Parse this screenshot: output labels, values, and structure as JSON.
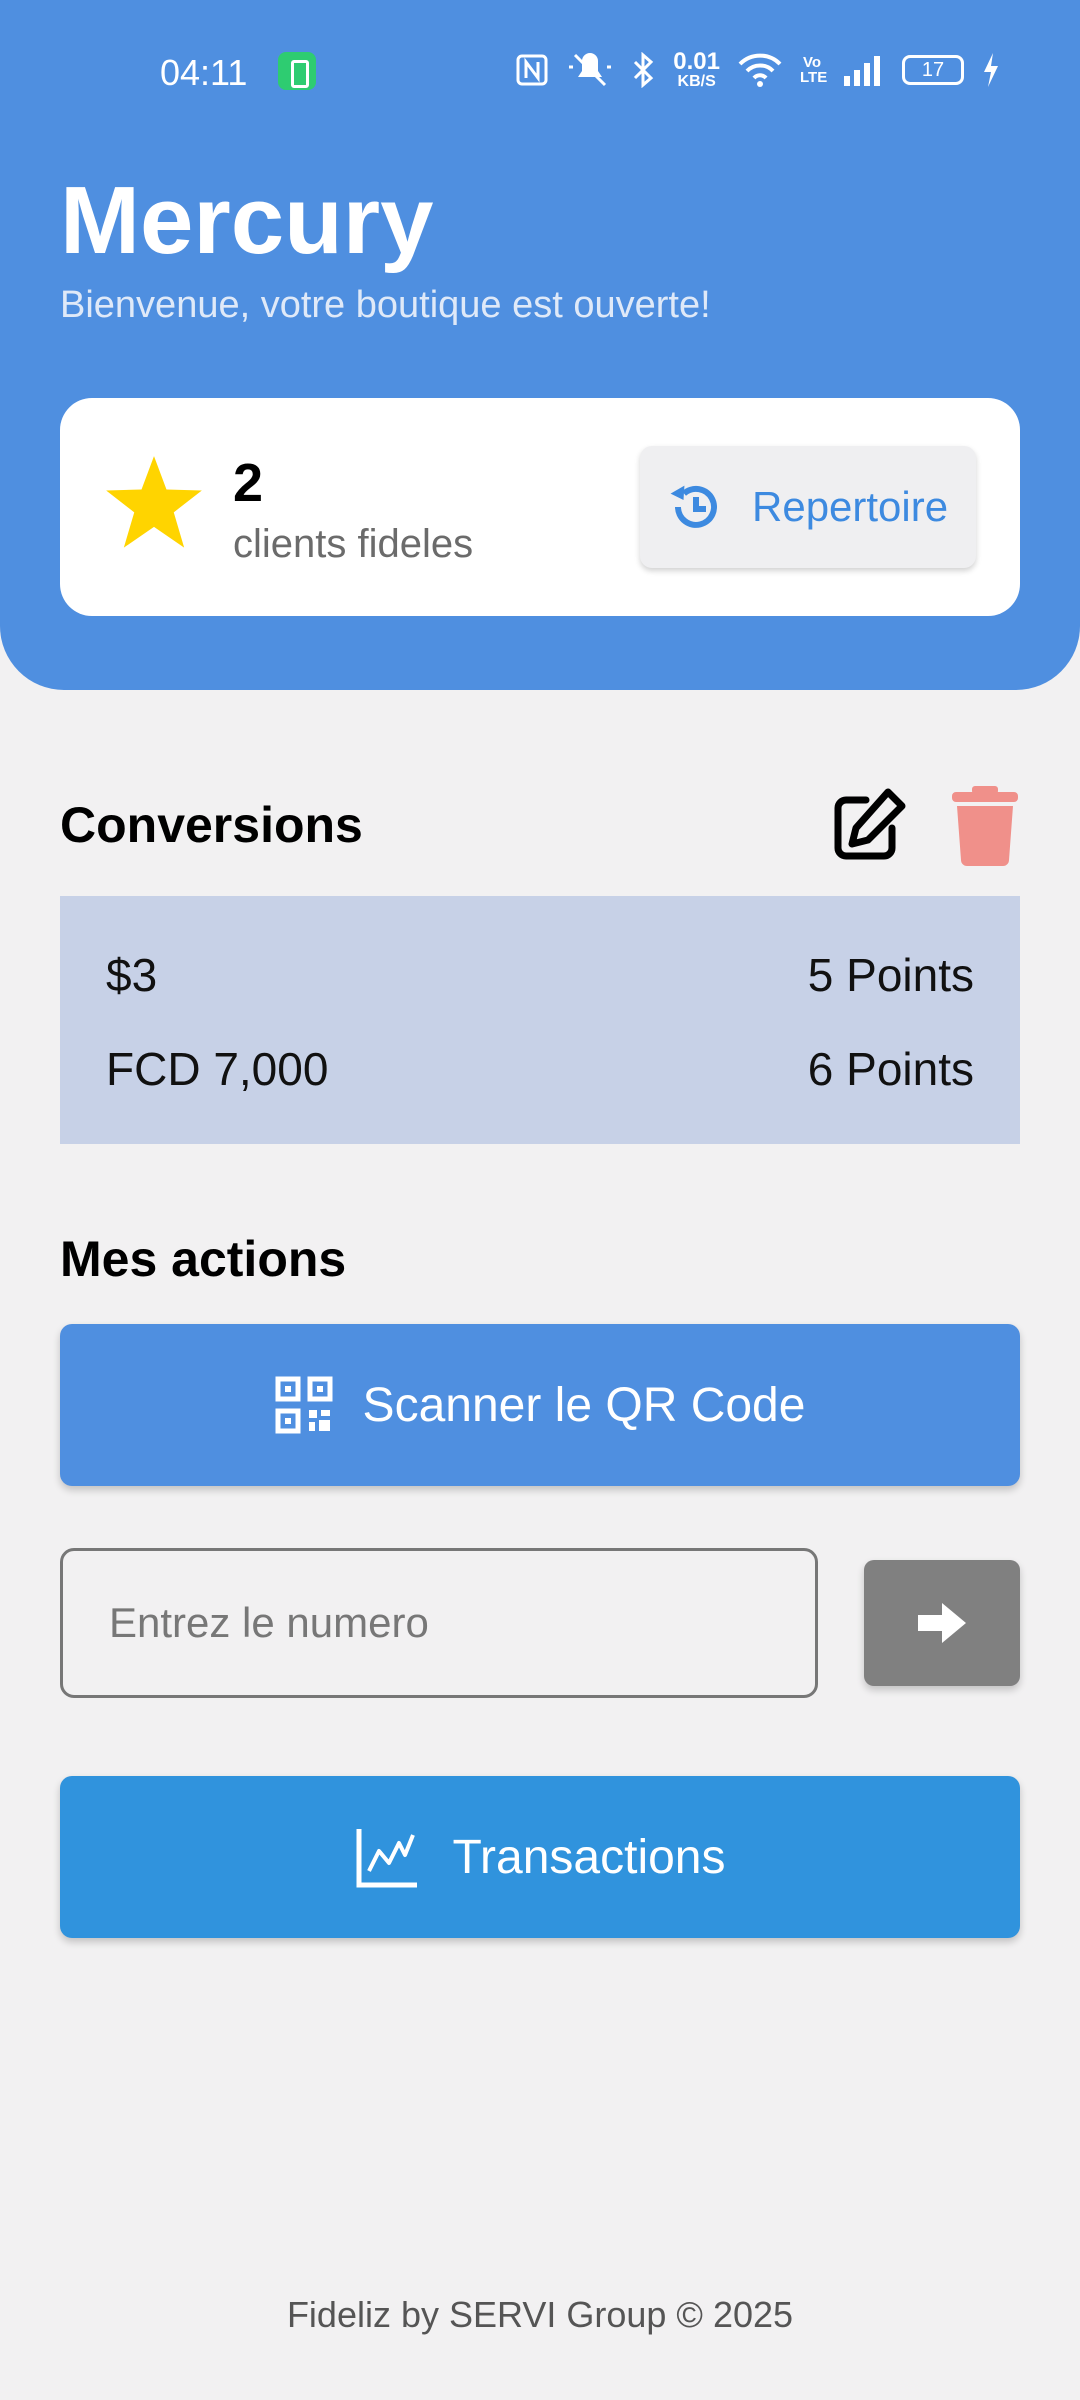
{
  "status_bar": {
    "time": "04:11",
    "net_speed_value": "0.01",
    "net_speed_unit": "KB/S",
    "volte": "Vo LTE",
    "battery": "17"
  },
  "header": {
    "title": "Mercury",
    "subtitle": "Bienvenue, votre boutique est ouverte!"
  },
  "loyalty_card": {
    "count": "2",
    "label": "clients fideles",
    "repertoire_label": "Repertoire",
    "icon": "star-icon",
    "star_color": "#ffd400"
  },
  "conversions": {
    "title": "Conversions",
    "rows": [
      {
        "amount": "$3",
        "points": "5 Points"
      },
      {
        "amount": "FCD 7,000",
        "points": "6 Points"
      }
    ],
    "edit_icon": "edit-icon",
    "delete_icon": "trash-icon",
    "delete_color": "#f0908a"
  },
  "actions": {
    "title": "Mes actions",
    "scan_label": "Scanner le QR Code",
    "number_placeholder": "Entrez le numero",
    "transactions_label": "Transactions"
  },
  "footer": {
    "text": "Fideliz by SERVI Group © 2025"
  },
  "colors": {
    "primary": "#4f8fe0",
    "transactions": "#3093dd",
    "background": "#f2f1f2",
    "conversion_box": "#c7d1e7"
  }
}
